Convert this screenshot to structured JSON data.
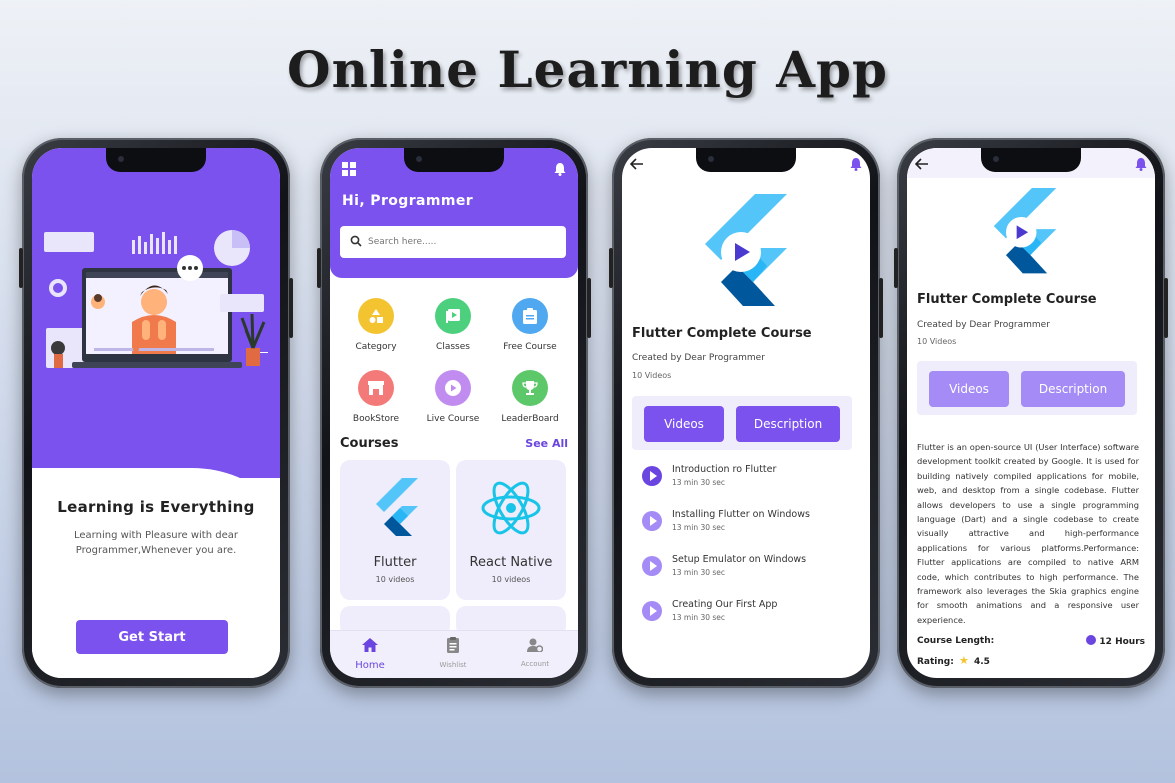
{
  "headline": "Online Learning App",
  "colors": {
    "accent": "#7b52ee",
    "accent_light": "#a48bf5",
    "card_bg": "#efedfb"
  },
  "screen1": {
    "title": "Learning is Everything",
    "subtitle": "Learning with Pleasure with dear Programmer,Whenever you are.",
    "button": "Get Start"
  },
  "screen2": {
    "greeting": "Hi, Programmer",
    "search_placeholder": "Search here.....",
    "categories": [
      {
        "label": "Category",
        "color": "#f4c430",
        "icon": "shapes-icon"
      },
      {
        "label": "Classes",
        "color": "#4cd07d",
        "icon": "video-library-icon"
      },
      {
        "label": "Free Course",
        "color": "#4fa8f0",
        "icon": "clipboard-icon"
      },
      {
        "label": "BookStore",
        "color": "#f47a7a",
        "icon": "store-icon"
      },
      {
        "label": "Live Course",
        "color": "#c18cf0",
        "icon": "play-circle-icon"
      },
      {
        "label": "LeaderBoard",
        "color": "#5cc86a",
        "icon": "trophy-icon"
      }
    ],
    "courses_heading": "Courses",
    "see_all": "See All",
    "courses": [
      {
        "name": "Flutter",
        "count": "10 videos",
        "icon": "flutter-logo"
      },
      {
        "name": "React Native",
        "count": "10 videos",
        "icon": "react-logo"
      }
    ],
    "nav": [
      {
        "label": "Home",
        "icon": "home-icon"
      },
      {
        "label": "Wishlist",
        "icon": "wishlist-icon"
      },
      {
        "label": "Account",
        "icon": "account-icon"
      }
    ]
  },
  "screen3": {
    "course_title": "Flutter Complete Course",
    "created_by": "Created by Dear Programmer",
    "videos_count": "10 Videos",
    "tab_videos": "Videos",
    "tab_description": "Description",
    "lessons": [
      {
        "title": "Introduction ro Flutter",
        "duration": "13 min 30 sec"
      },
      {
        "title": "Installing Flutter on Windows",
        "duration": "13 min 30 sec"
      },
      {
        "title": "Setup Emulator on Windows",
        "duration": "13 min 30 sec"
      },
      {
        "title": "Creating Our First App",
        "duration": "13 min 30 sec"
      }
    ]
  },
  "screen4": {
    "course_title": "Flutter Complete Course",
    "created_by": "Created by Dear Programmer",
    "videos_count": "10 Videos",
    "tab_videos": "Videos",
    "tab_description": "Description",
    "description": "Flutter is an open-source UI (User Interface) software development toolkit created by Google. It is used for building natively compiled applications for mobile, web, and desktop from a single codebase. Flutter allows developers to use a single programming language (Dart) and a single codebase to create visually attractive and high-performance applications for various platforms.Performance: Flutter applications are compiled to native ARM code, which contributes to high performance. The framework also leverages the Skia graphics engine for smooth animations and a responsive user experience.",
    "course_length_label": "Course Length:",
    "course_length_value": "12 Hours",
    "rating_label": "Rating:",
    "rating_value": "4.5"
  }
}
